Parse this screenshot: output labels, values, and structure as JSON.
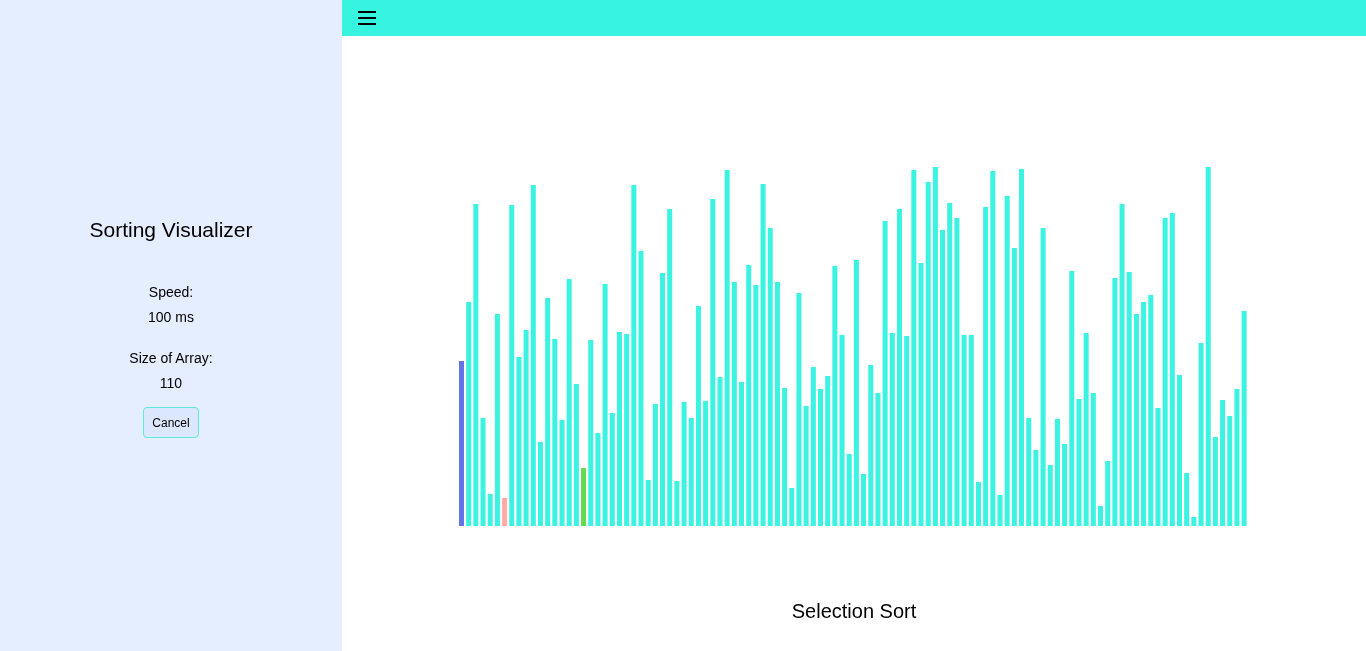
{
  "sidebar": {
    "title": "Sorting Visualizer",
    "speed": {
      "label": "Speed:",
      "value": "100 ms"
    },
    "array_size": {
      "label": "Size of Array:",
      "value": "110"
    },
    "cancel_button": {
      "label": "Cancel"
    }
  },
  "visualizer": {
    "algorithm": "Selection Sort"
  }
}
